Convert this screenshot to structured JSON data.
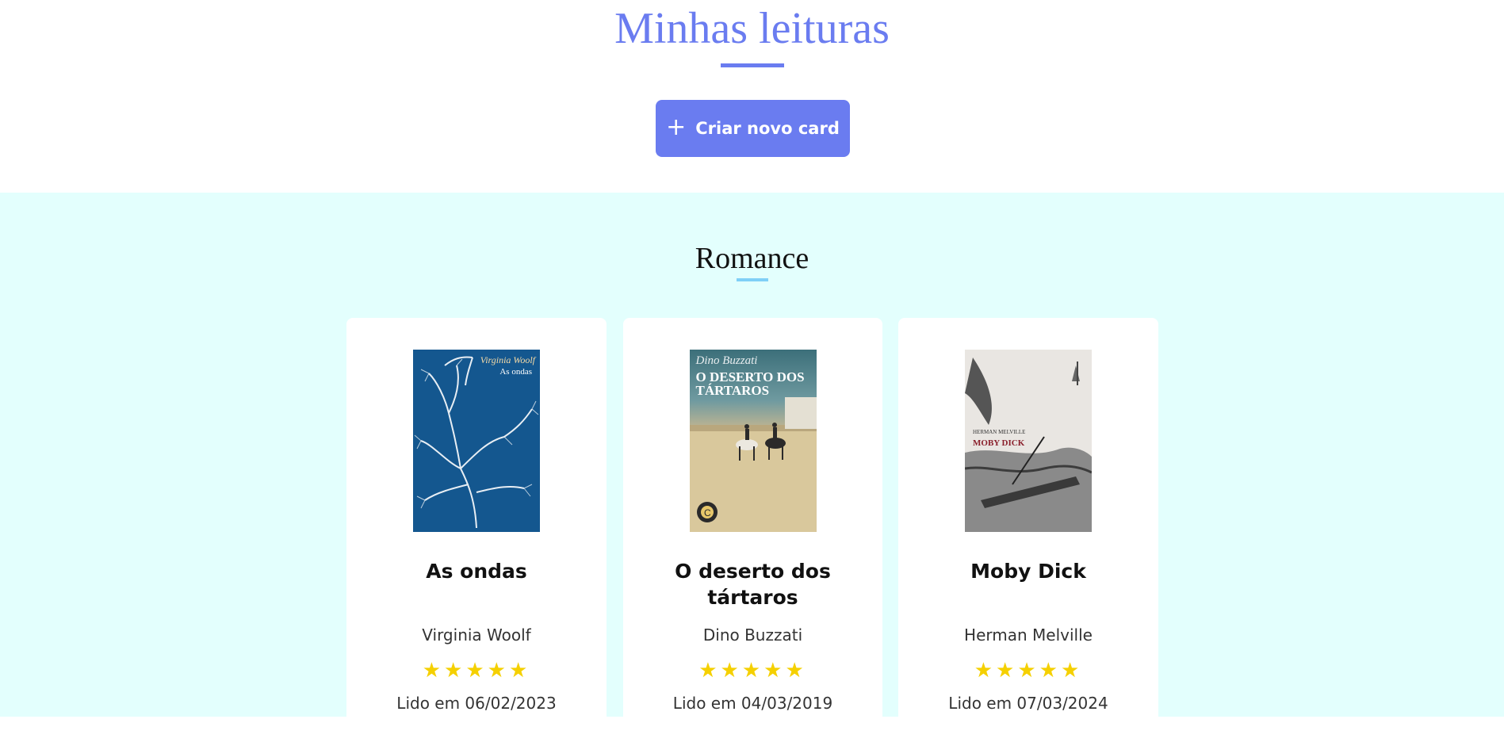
{
  "header": {
    "title": "Minhas leituras",
    "create_button_label": "Criar novo card"
  },
  "section": {
    "title": "Romance",
    "cards": [
      {
        "title": "As ondas",
        "author": "Virginia Woolf",
        "rating": 5,
        "stars": "★★★★★",
        "read_date": "Lido em 06/02/2023",
        "cover": {
          "author": "Virginia Woolf",
          "title": "As ondas",
          "color": "#14578f"
        }
      },
      {
        "title": "O deserto dos tártaros",
        "author": "Dino Buzzati",
        "rating": 5,
        "stars": "★★★★★",
        "read_date": "Lido em 04/03/2019",
        "cover": {
          "author": "Dino Buzzati",
          "title": "O DESERTO DOS TÁRTAROS"
        }
      },
      {
        "title": "Moby Dick",
        "author": "Herman Melville",
        "rating": 5,
        "stars": "★★★★★",
        "read_date": "Lido em 07/03/2024",
        "cover": {
          "author": "HERMAN MELVILLE",
          "title": "MOBY DICK"
        }
      }
    ]
  },
  "colors": {
    "accent": "#6a7cf0",
    "section_bg": "#e3fffd",
    "star": "#f5d000",
    "section_underline": "#7fd0f7"
  },
  "icons": {
    "create_button": "plus-icon",
    "rating": "star-icon"
  }
}
